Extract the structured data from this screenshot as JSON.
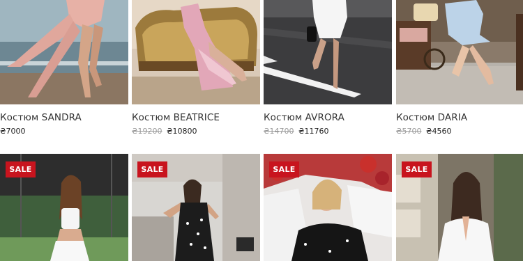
{
  "products_row1": [
    {
      "title": "Костюм SANDRA",
      "old_price": "",
      "price": "₴7000"
    },
    {
      "title": "Костюм BEATRICE",
      "old_price": "₴19200",
      "price": "₴10800"
    },
    {
      "title": "Костюм AVRORA",
      "old_price": "₴14700",
      "price": "₴11760"
    },
    {
      "title": "Костюм DARIA",
      "old_price": "₴5700",
      "price": "₴4560"
    }
  ],
  "products_row2": [
    {
      "badge": "SALE"
    },
    {
      "badge": "SALE"
    },
    {
      "badge": "SALE"
    },
    {
      "badge": "SALE"
    }
  ],
  "colors": {
    "sale_badge": "#c8141e",
    "old_price": "#9a9a9a",
    "title_text": "#333333"
  }
}
